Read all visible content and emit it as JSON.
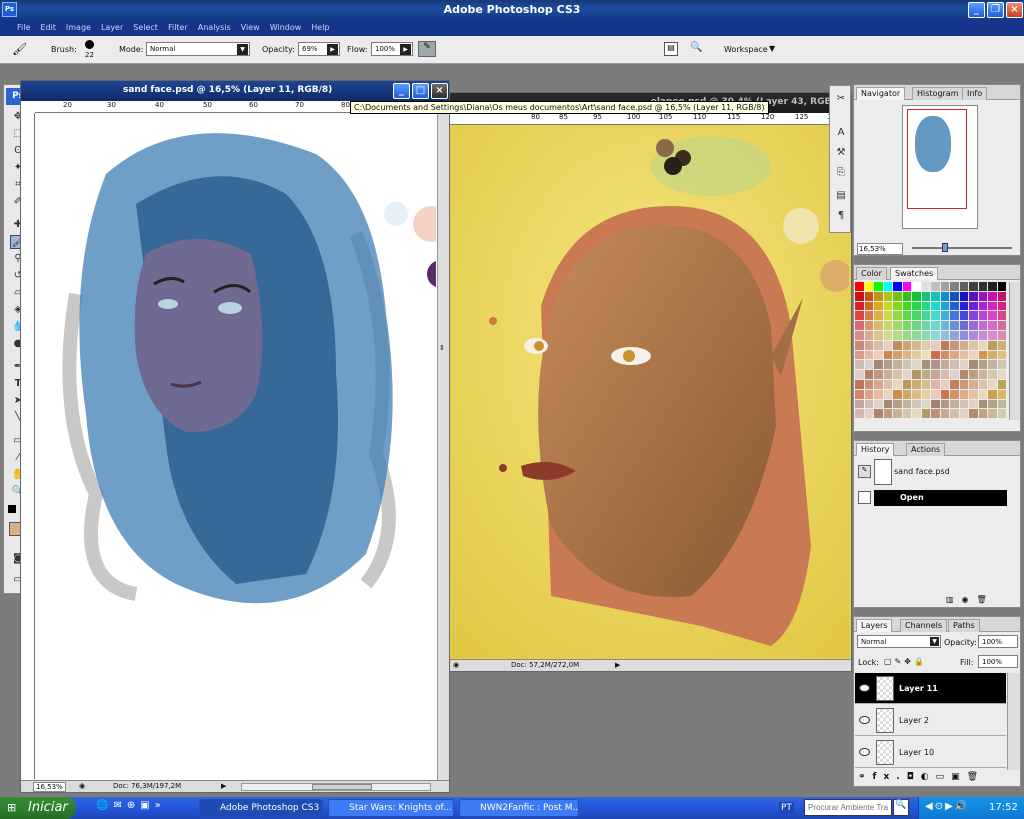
{
  "app": {
    "title": "Adobe Photoshop CS3",
    "icon": "Ps"
  },
  "menu": [
    "File",
    "Edit",
    "Image",
    "Layer",
    "Select",
    "Filter",
    "Analysis",
    "View",
    "Window",
    "Help"
  ],
  "options": {
    "brush_label": "Brush:",
    "brush_size": "22",
    "mode_label": "Mode:",
    "mode_value": "Normal",
    "opacity_label": "Opacity:",
    "opacity_value": "69%",
    "flow_label": "Flow:",
    "flow_value": "100%",
    "workspace_label": "Workspace"
  },
  "doc1": {
    "title": "sand face.psd @ 16,5% (Layer 11, RGB/8)",
    "ruler": [
      "20",
      "30",
      "40",
      "50",
      "60",
      "70",
      "80",
      "90"
    ],
    "zoom": "16,53%",
    "doc_size": "Doc: 76,3M/197,2M"
  },
  "doc2": {
    "title": "elanee.psd @ 30,4% (Layer 43, RGB/8)",
    "ruler": [
      "80",
      "85",
      "90",
      "95",
      "100",
      "105",
      "110",
      "115",
      "120",
      "125",
      "130"
    ],
    "doc_size": "Doc: 57,2M/272,0M"
  },
  "tooltip": "C:\\Documents and Settings\\Diana\\Os meus documentos\\Art\\sand face.psd @ 16,5% (Layer 11, RGB/8)",
  "navigator": {
    "tabs": [
      "Navigator",
      "Histogram",
      "Info"
    ],
    "zoom": "16,53%"
  },
  "color": {
    "tabs": [
      "Color",
      "Swatches"
    ]
  },
  "history": {
    "tabs": [
      "History",
      "Actions"
    ],
    "snapshot": "sand face.psd",
    "items": [
      "Open"
    ]
  },
  "layers": {
    "tabs": [
      "Layers",
      "Channels",
      "Paths"
    ],
    "blend": "Normal",
    "opacity_label": "Opacity:",
    "opacity": "100%",
    "lock_label": "Lock:",
    "fill_label": "Fill:",
    "fill": "100%",
    "items": [
      "Layer 11",
      "Layer 2",
      "Layer 10"
    ],
    "fx": "fx."
  },
  "taskbar": {
    "start": "Iniciar",
    "tasks": [
      "Adobe Photoshop CS3",
      "Star Wars: Knights of...",
      "NWN2Fanfic : Post M..."
    ],
    "lang": "PT",
    "search_placeholder": "Procurar Ambiente Tra",
    "time": "17:52"
  },
  "colors": {
    "fg": "#d8b089",
    "bg": "#b0351c",
    "selection": "#000000",
    "canvas2": "#e7d24a"
  }
}
